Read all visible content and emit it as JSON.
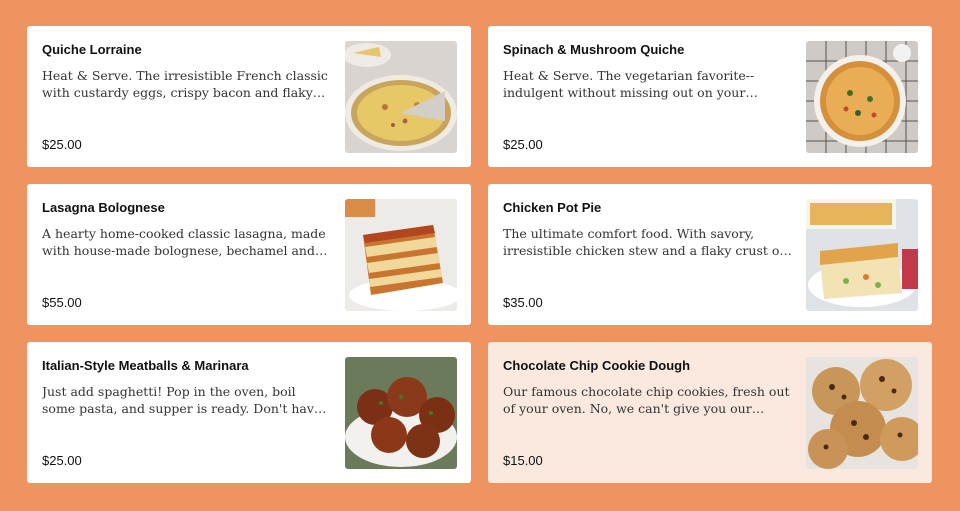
{
  "menu": {
    "items": [
      {
        "name": "Quiche Lorraine",
        "description": "Heat & Serve. The irresistible French classic with custardy eggs, crispy bacon and flaky pie crust.",
        "price": "$25.00",
        "image_icon": "quiche-lorraine-image"
      },
      {
        "name": "Spinach & Mushroom Quiche",
        "description": "Heat & Serve. The vegetarian favorite--indulgent without missing out on your veggies. Popeye would approve.",
        "price": "$25.00",
        "image_icon": "spinach-quiche-image"
      },
      {
        "name": "Lasagna Bolognese",
        "description": "A hearty home-cooked classic lasagna, made with house-made bolognese, bechamel and parmesan.",
        "price": "$55.00",
        "image_icon": "lasagna-image"
      },
      {
        "name": "Chicken Pot Pie",
        "description": "The ultimate comfort food. With savory, irresistible chicken stew and a flaky crust on top.",
        "price": "$35.00",
        "image_icon": "pot-pie-image"
      },
      {
        "name": "Italian-Style Meatballs & Marinara",
        "description": "Just add spaghetti! Pop in the oven, boil some pasta, and supper is ready. Don't have an entire evening?",
        "price": "$25.00",
        "image_icon": "meatballs-image"
      },
      {
        "name": "Chocolate Chip Cookie Dough",
        "description": "Our famous chocolate chip cookies, fresh out of your oven. No, we can't give you our secret recipe.",
        "price": "$15.00",
        "image_icon": "cookies-image"
      }
    ]
  },
  "colors": {
    "page_background": "#ee9461",
    "card_background": "#ffffff",
    "highlighted_card_background": "#fbe9e0"
  }
}
